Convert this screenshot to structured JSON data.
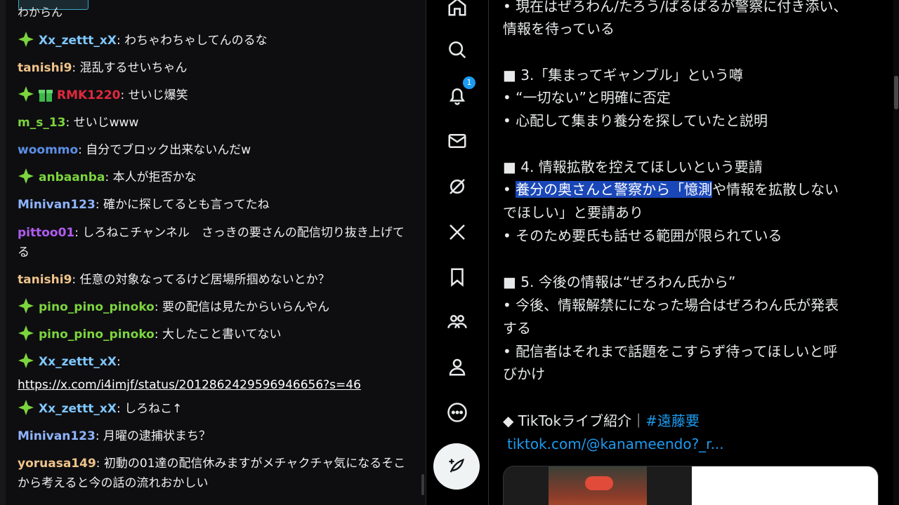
{
  "chat": {
    "top_text": "わからん",
    "messages": [
      {
        "user": "Xx_zettt_xX",
        "color": "#7fc8ff",
        "badges": [
          "gem"
        ],
        "text": "わちゃわちゃしてんのるな"
      },
      {
        "user": "tanishi9",
        "color": "#f0c38a",
        "badges": [],
        "text": "混乱するせいちゃん"
      },
      {
        "user": "RMK1220",
        "color": "#e0293d",
        "badges": [
          "gem",
          "gift"
        ],
        "text": "せいじ爆笑"
      },
      {
        "user": "m_s_13",
        "color": "#7cd43e",
        "badges": [],
        "text": "せいじwww"
      },
      {
        "user": "woommo",
        "color": "#5b8fe6",
        "badges": [],
        "text": "自分でブロック出来ないんだw"
      },
      {
        "user": "anbaanba",
        "color": "#7cd43e",
        "badges": [
          "gem"
        ],
        "text": "本人が拒否かな"
      },
      {
        "user": "Minivan123",
        "color": "#8fb5ff",
        "badges": [],
        "text": "確かに探してるとも言ってたね"
      },
      {
        "user": "pittoo01",
        "color": "#b05cf0",
        "badges": [],
        "text": "しろねこチャンネル　さっきの要さんの配信切り抜き上げてる"
      },
      {
        "user": "tanishi9",
        "color": "#f0c38a",
        "badges": [],
        "text": "任意の対象なってるけど居場所掴めないとか？"
      },
      {
        "user": "pino_pino_pinoko",
        "color": "#7cd43e",
        "badges": [
          "gem"
        ],
        "text": "要の配信は見たからいらんやん"
      },
      {
        "user": "pino_pino_pinoko",
        "color": "#7cd43e",
        "badges": [
          "gem"
        ],
        "text": "大したこと書いてない"
      },
      {
        "user": "Xx_zettt_xX",
        "color": "#7fc8ff",
        "badges": [
          "gem"
        ],
        "text": "",
        "link": "https://x.com/i4imjf/status/2012862429596946656?s=46"
      },
      {
        "user": "Xx_zettt_xX",
        "color": "#7fc8ff",
        "badges": [
          "gem"
        ],
        "text": "しろねこ↑"
      },
      {
        "user": "Minivan123",
        "color": "#8fb5ff",
        "badges": [],
        "text": "月曜の逮捕状まち？"
      },
      {
        "user": "yoruasa149",
        "color": "#f0c38a",
        "badges": [],
        "text": "初動の01達の配信休みますがメチャクチャ気になるそこから考えると今の話の流れおかしい"
      }
    ]
  },
  "nav": {
    "notification_count": "1",
    "items": [
      "home-icon",
      "search-icon",
      "bell-icon",
      "mail-icon",
      "grok-icon",
      "x-logo-icon",
      "bookmark-icon",
      "communities-icon",
      "profile-icon",
      "more-icon"
    ]
  },
  "post": {
    "lines": [
      {
        "text": "• 現在はぜろわん/たろう/ぱるぱるが警察に付き添い、"
      },
      {
        "text": "情報を待っている"
      },
      {
        "text": "■ 3.「集まってギャンブル」という噂"
      },
      {
        "text": "• “一切ない”と明確に否定"
      },
      {
        "text": "• 心配して集まり養分を探していたと説明"
      },
      {
        "text": "■ 4. 情報拡散を控えてほしいという要請"
      },
      {
        "text_pre": "• ",
        "text_hl": "養分の奥さんと警察から「憶測",
        "text_post": "や情報を拡散しない"
      },
      {
        "text": "でほしい」と要請あり"
      },
      {
        "text": "• そのため要氏も話せる範囲が限られている"
      },
      {
        "text": "■ 5. 今後の情報は“ぜろわん氏から”"
      },
      {
        "text": "• 今後、情報解禁にになった場合はぜろわん氏が発表"
      },
      {
        "text": "する"
      },
      {
        "text": "• 配信者はそれまで話題をこすらず待ってほしいと呼"
      },
      {
        "text": "びかけ"
      }
    ],
    "tiktok_prefix": "◆ TikTokライブ紹介｜",
    "tiktok_hashtag": "#遠藤要",
    "tiktok_link": "tiktok.com/@kanameendo?_r..."
  }
}
